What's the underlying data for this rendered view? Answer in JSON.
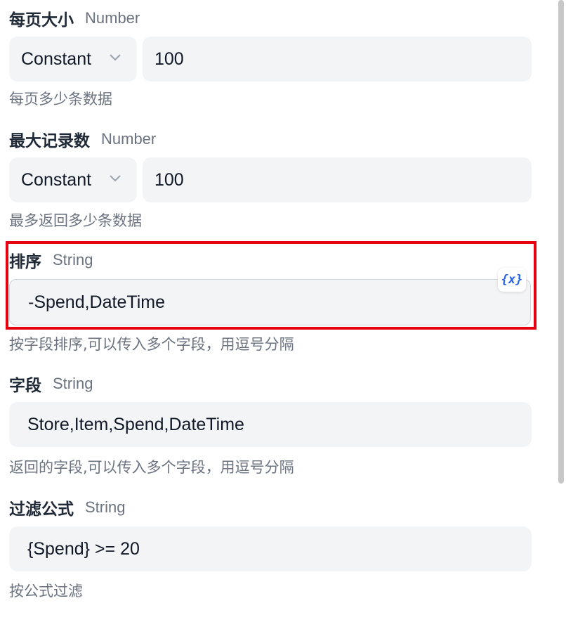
{
  "fields": {
    "page_size": {
      "label": "每页大小",
      "type": "Number",
      "mode": "Constant",
      "value": "100",
      "help": "每页多少条数据"
    },
    "max_records": {
      "label": "最大记录数",
      "type": "Number",
      "mode": "Constant",
      "value": "100",
      "help": "最多返回多少条数据"
    },
    "sort": {
      "label": "排序",
      "type": "String",
      "value": "-Spend,DateTime",
      "variable_button": "{x}",
      "help": "按字段排序,可以传入多个字段，用逗号分隔"
    },
    "fields_list": {
      "label": "字段",
      "type": "String",
      "value": "Store,Item,Spend,DateTime",
      "help": "返回的字段,可以传入多个字段，用逗号分隔"
    },
    "filter_formula": {
      "label": "过滤公式",
      "type": "String",
      "value": "{Spend} >= 20",
      "help": "按公式过滤"
    }
  },
  "colors": {
    "highlight": "#e5000f",
    "accent": "#2563eb",
    "field_bg": "#f3f4f6"
  },
  "icons": {
    "select_chevron": "chevron-down-icon",
    "variable": "variable-icon"
  }
}
